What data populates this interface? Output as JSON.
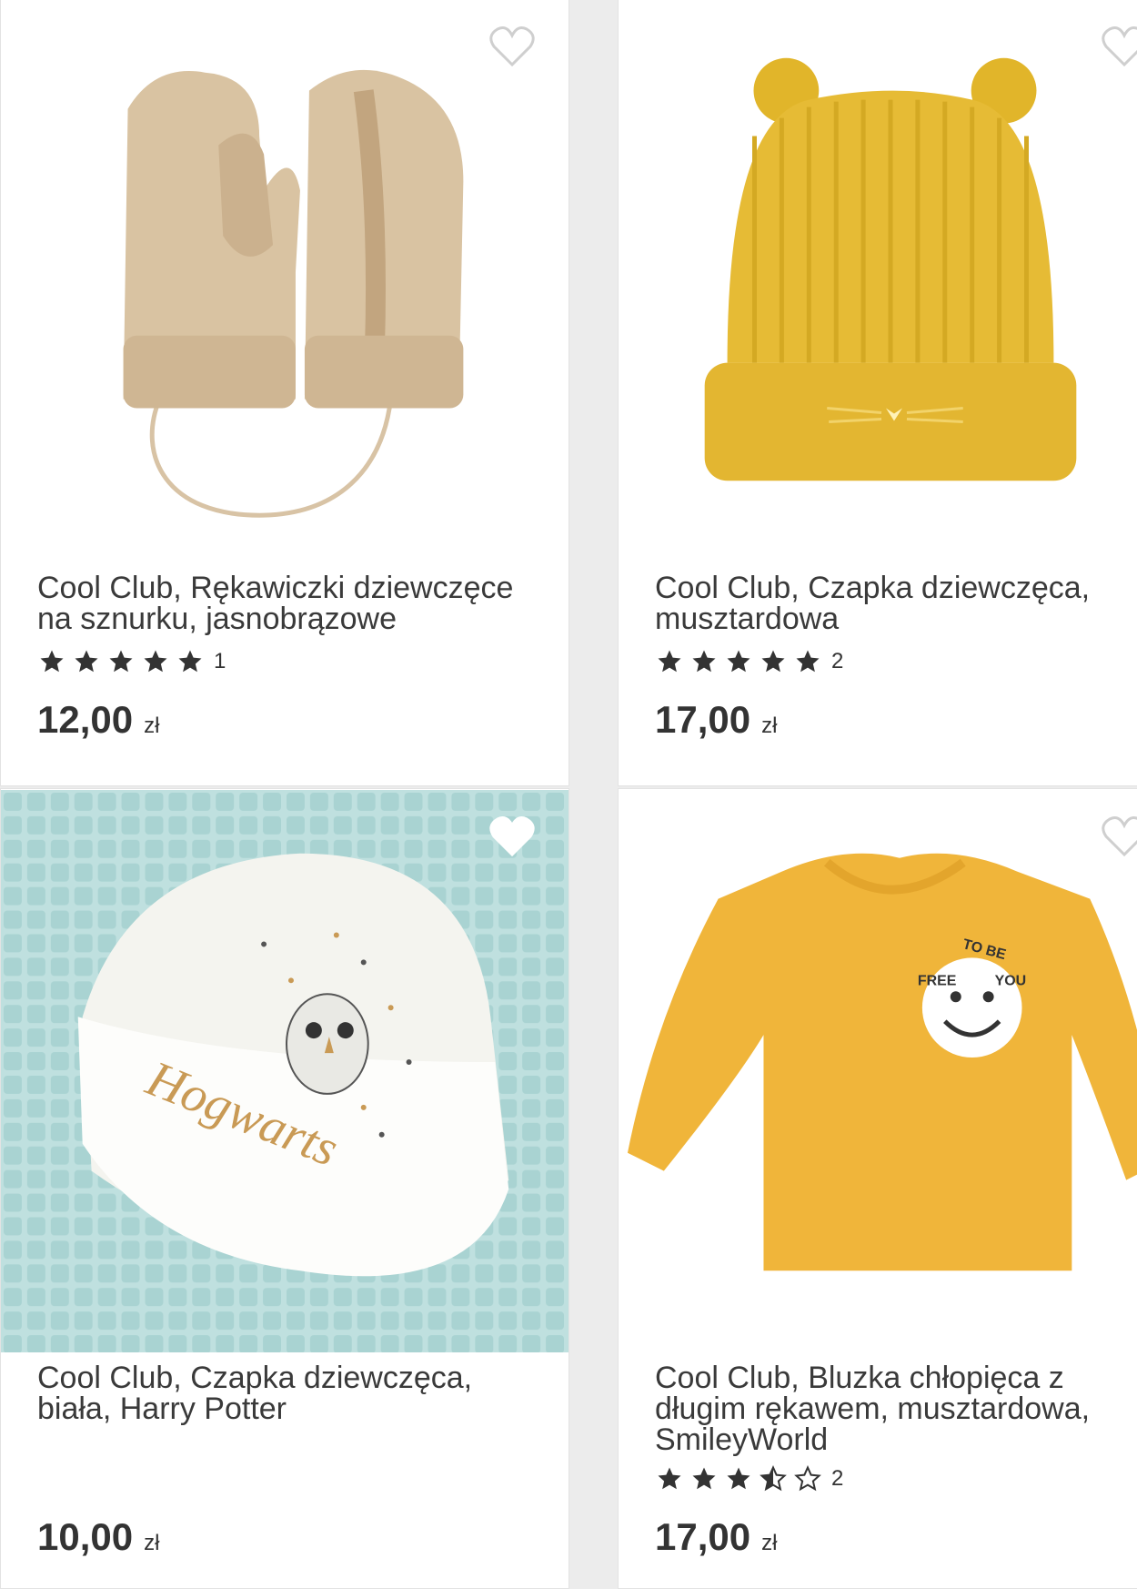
{
  "products": [
    {
      "title": "Cool Club, Rękawiczki dziewczęce na sznurku, jasnobrązowe",
      "rating_stars": 5,
      "review_count": "1",
      "price": "12,00",
      "currency": "zł",
      "image_icon": "mittens-image",
      "favorite_filled": false
    },
    {
      "title": "Cool Club, Czapka dziewczęca, musztardowa",
      "rating_stars": 5,
      "review_count": "2",
      "price": "17,00",
      "currency": "zł",
      "image_icon": "beanie-image",
      "favorite_filled": false
    },
    {
      "title": "Cool Club, Czapka dziewczęca, biała, Harry Potter",
      "price": "10,00",
      "currency": "zł",
      "image_icon": "hogwarts-hat-image",
      "image_text": "Hogwarts",
      "favorite_filled": true
    },
    {
      "title": "Cool Club, Bluzka chłopięca z długim rękawem, musztardowa, SmileyWorld",
      "rating_stars": 3.5,
      "review_count": "2",
      "price": "17,00",
      "currency": "zł",
      "image_icon": "sweatshirt-image",
      "image_text_1": "FREE",
      "image_text_2": "TO BE",
      "image_text_3": "YOU",
      "favorite_filled": false
    }
  ],
  "colors": {
    "star": "#333333",
    "background": "#ececec",
    "mustard": "#e6b930",
    "beige": "#d9c3a2",
    "mint": "#bfe0df"
  }
}
